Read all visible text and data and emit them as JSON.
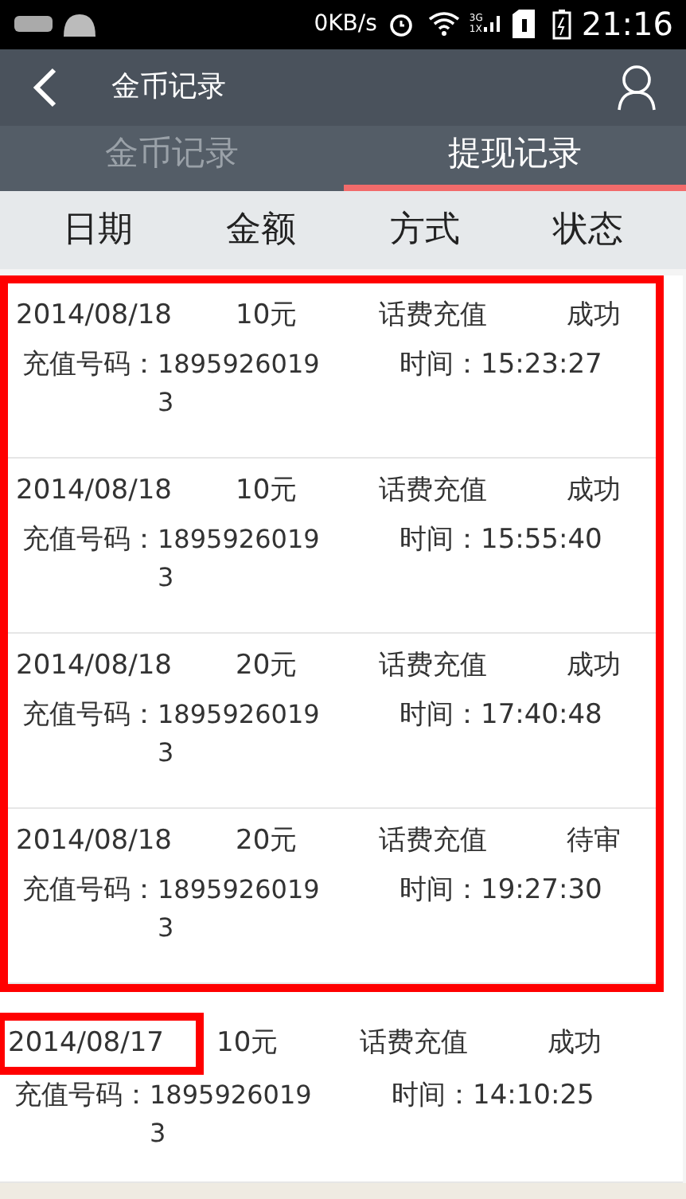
{
  "status_bar": {
    "speed": "0KB/s",
    "network": "3G",
    "network2": "1X",
    "time": "21:16"
  },
  "header": {
    "title": "金币记录"
  },
  "tabs": [
    {
      "label": "金币记录",
      "selected": false
    },
    {
      "label": "提现记录",
      "selected": true
    }
  ],
  "columns": [
    "日期",
    "金额",
    "方式",
    "状态"
  ],
  "records": [
    {
      "date": "2014/08/18",
      "amount": "10元",
      "method": "话费充值",
      "status": "成功",
      "phone_label": "充值号码：",
      "phone": "18959260193",
      "time_label": "时间：",
      "time": "15:23:27",
      "in_frame": true,
      "date_marked": false
    },
    {
      "date": "2014/08/18",
      "amount": "10元",
      "method": "话费充值",
      "status": "成功",
      "phone_label": "充值号码：",
      "phone": "18959260193",
      "time_label": "时间：",
      "time": "15:55:40",
      "in_frame": true,
      "date_marked": false
    },
    {
      "date": "2014/08/18",
      "amount": "20元",
      "method": "话费充值",
      "status": "成功",
      "phone_label": "充值号码：",
      "phone": "18959260193",
      "time_label": "时间：",
      "time": "17:40:48",
      "in_frame": true,
      "date_marked": false
    },
    {
      "date": "2014/08/18",
      "amount": "20元",
      "method": "话费充值",
      "status": "待审",
      "phone_label": "充值号码：",
      "phone": "18959260193",
      "time_label": "时间：",
      "time": "19:27:30",
      "in_frame": true,
      "date_marked": false
    },
    {
      "date": "2014/08/17",
      "amount": "10元",
      "method": "话费充值",
      "status": "成功",
      "phone_label": "充值号码：",
      "phone": "18959260193",
      "time_label": "时间：",
      "time": "14:10:25",
      "in_frame": false,
      "date_marked": true
    }
  ]
}
